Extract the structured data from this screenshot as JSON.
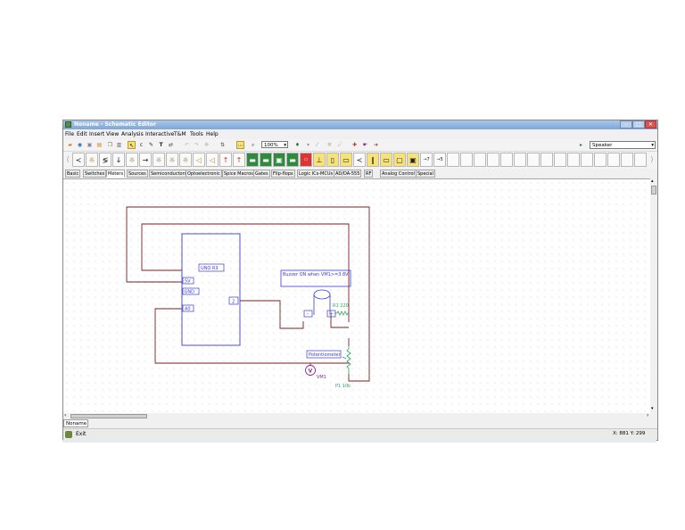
{
  "window": {
    "title": "Noname - Schematic Editor"
  },
  "menu": [
    "File",
    "Edit",
    "Insert",
    "View",
    "Analysis",
    "Interactive",
    "T&M",
    "Tools",
    "Help"
  ],
  "toolbar": {
    "zoom": "100%",
    "component": "Speaker"
  },
  "palette_tabs": [
    "Basic",
    "Switches",
    "Meters",
    "Sources",
    "Semiconductors",
    "Optoelectronic",
    "Spice Macros",
    "Gates",
    "Flip-flops",
    "Logic ICs-MCUs",
    "AD/DA-555",
    "RF",
    "Analog Control",
    "Special"
  ],
  "active_tab": "Meters",
  "schematic": {
    "arduino_label": "UNO R3",
    "pin_5v": "5V",
    "pin_gnd": "GND",
    "pin_a0": "A0",
    "pin_2": "2",
    "note": "Buzzer ON when VM1>=3.8V",
    "buzzer_minus": "-",
    "buzzer_plus": "+",
    "resistor": "R1 220",
    "potentiometer_label": "Potentiometer",
    "pot_name": "P1 10k",
    "voltmeter_symbol": "V",
    "voltmeter_name": "VM1"
  },
  "document_tab": "Noname",
  "status": {
    "exit": "Exit",
    "coords": "X: 881 Y: 299"
  },
  "colors": {
    "wire": "#7a1f1f",
    "component": "#3b3bd6",
    "label": "#2e9e5e",
    "meter": "#8e2a8e"
  }
}
